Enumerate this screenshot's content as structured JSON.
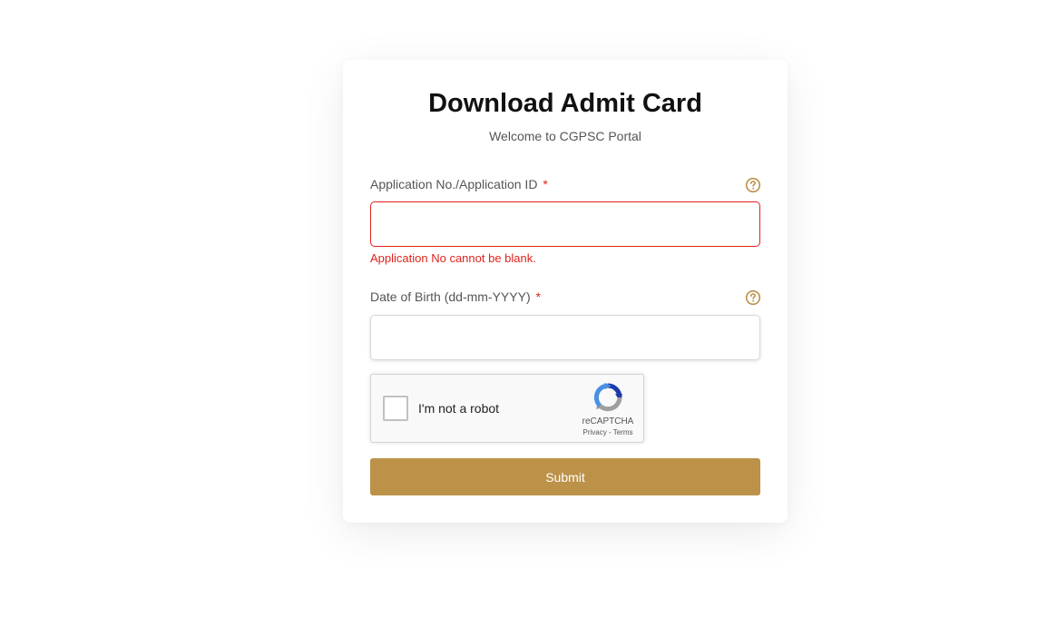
{
  "form": {
    "title": "Download Admit Card",
    "subtitle": "Welcome to CGPSC Portal",
    "application_field": {
      "label": "Application No./Application ID",
      "required_mark": "*",
      "value": "",
      "error": "Application No cannot be blank.",
      "help_icon": "question-circle-icon"
    },
    "dob_field": {
      "label": "Date of Birth (dd-mm-YYYY)",
      "required_mark": "*",
      "value": "",
      "help_icon": "question-circle-icon"
    },
    "captcha": {
      "label": "I'm not a robot",
      "brand": "reCAPTCHA",
      "privacy": "Privacy",
      "separator": "-",
      "terms": "Terms",
      "checked": false
    },
    "submit_label": "Submit"
  },
  "colors": {
    "accent": "#bc9148",
    "error": "#e0231c",
    "help_icon": "#bc9148"
  }
}
